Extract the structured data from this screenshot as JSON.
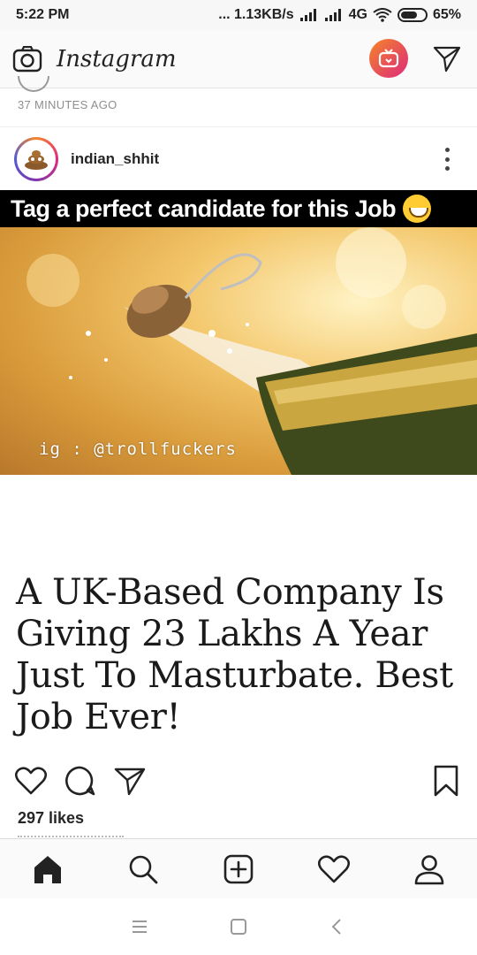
{
  "status_bar": {
    "time": "5:22 PM",
    "network": "... 1.13KB/s",
    "network_type": "4G",
    "battery": "65%"
  },
  "header": {
    "app_name": "Instagram",
    "icons": [
      "camera-icon",
      "igtv-icon",
      "direct-message-icon"
    ]
  },
  "previous_post": {
    "timestamp": "37 MINUTES AGO"
  },
  "post": {
    "username": "indian_shhit",
    "caption_overlay": "Tag a perfect candidate for this Job",
    "watermark": "ig : @trollfuckers",
    "headline": "A UK-Based Company Is Giving 23 Lakhs A Year Just To Masturbate. Best Job Ever!",
    "likes": "297 likes"
  },
  "bottom_nav": {
    "items": [
      "home-icon",
      "search-icon",
      "new-post-icon",
      "activity-heart-icon",
      "profile-icon"
    ]
  },
  "colors": {
    "accent_gradient_start": "#f58529",
    "accent_gradient_end": "#dd2a7b"
  }
}
